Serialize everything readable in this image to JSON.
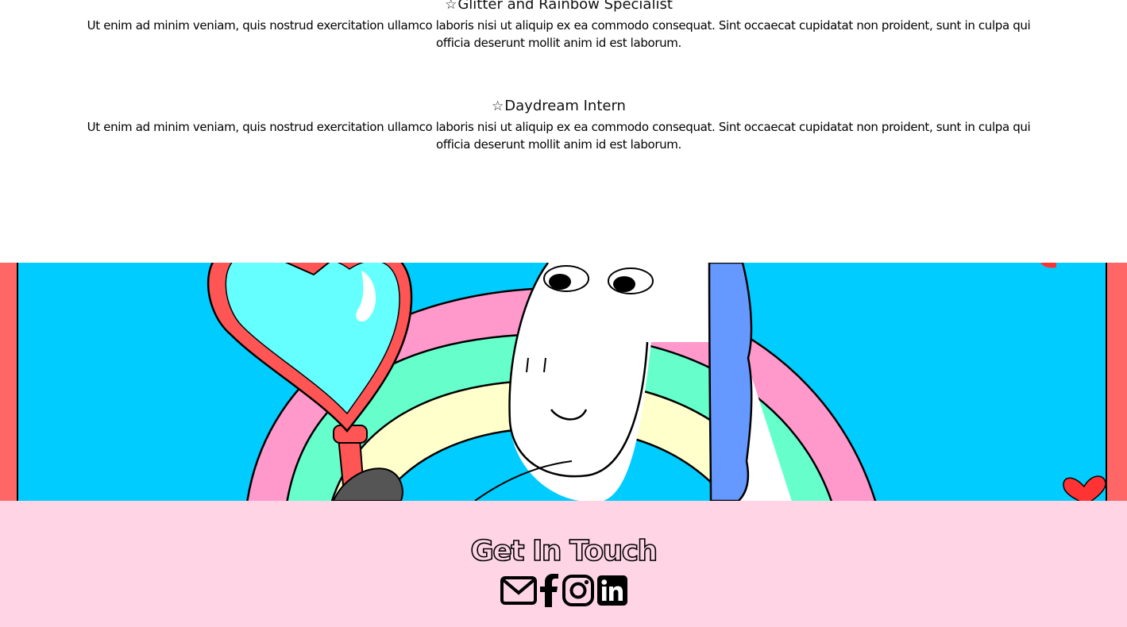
{
  "experience": {
    "jobs": [
      {
        "star": "☆",
        "title": "Glitter and Rainbow Specialist",
        "description": "Ut enim ad minim veniam, quis nostrud exercitation ullamco laboris nisi ut aliquip ex ea commodo consequat. Sint occaecat cupidatat non proident, sunt in culpa qui officia deserunt mollit anim id est laborum."
      },
      {
        "star": "☆",
        "title": "Daydream Intern",
        "description": "Ut enim ad minim veniam, quis nostrud exercitation ullamco laboris nisi ut aliquip ex ea commodo consequat. Sint occaecat cupidatat non proident, sunt in culpa qui officia deserunt mollit anim id est laborum."
      }
    ]
  },
  "hero": {
    "image": "unicorn-rainbow-illustration",
    "colors": {
      "sky": "#00ccff",
      "border": "#ff6666",
      "rainbow_pink": "#ff99cc",
      "rainbow_green": "#66ffcc",
      "rainbow_yellow": "#ffffcc",
      "balloon": "#66ffff",
      "mane": "#6699ff"
    }
  },
  "footer": {
    "title": "Get In Touch",
    "background": "#ffd5e5",
    "socials": [
      {
        "name": "email",
        "icon": "envelope-icon"
      },
      {
        "name": "facebook",
        "icon": "facebook-icon"
      },
      {
        "name": "instagram",
        "icon": "instagram-icon"
      },
      {
        "name": "linkedin",
        "icon": "linkedin-icon"
      }
    ]
  }
}
